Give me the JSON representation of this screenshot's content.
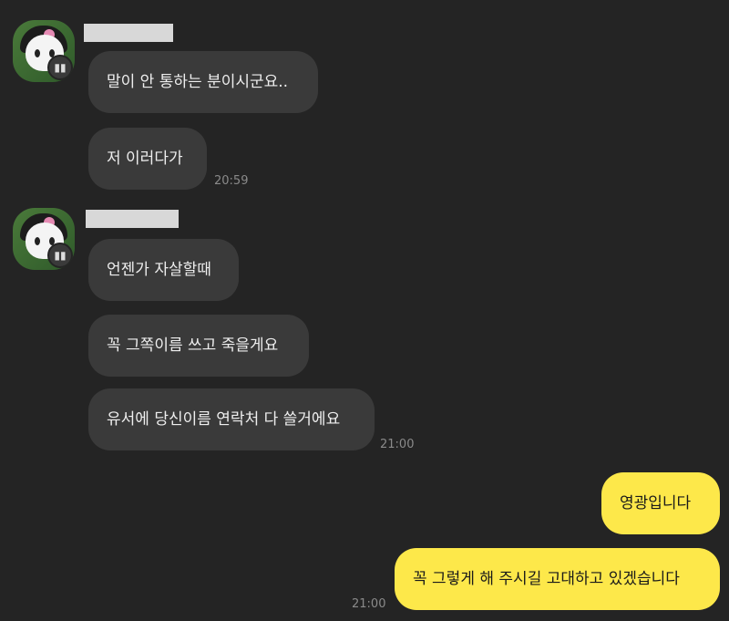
{
  "messages": [
    {
      "text": "말이 안 통하는 분이시군요.."
    },
    {
      "text": "저 이러다가"
    },
    {
      "text": "언젠가 자살할때"
    },
    {
      "text": "꼭 그쪽이름 쓰고 죽을게요"
    },
    {
      "text": "유서에 당신이름 연락처 다 쓸거에요"
    },
    {
      "text": "영광입니다"
    },
    {
      "text": "꼭 그렇게 해 주시길 고대하고 있겠습니다"
    }
  ],
  "times": [
    "20:59",
    "21:00",
    "21:00"
  ],
  "colors": {
    "background": "#242424",
    "incoming": "#3a3a3a",
    "outgoing": "#fde84a"
  }
}
